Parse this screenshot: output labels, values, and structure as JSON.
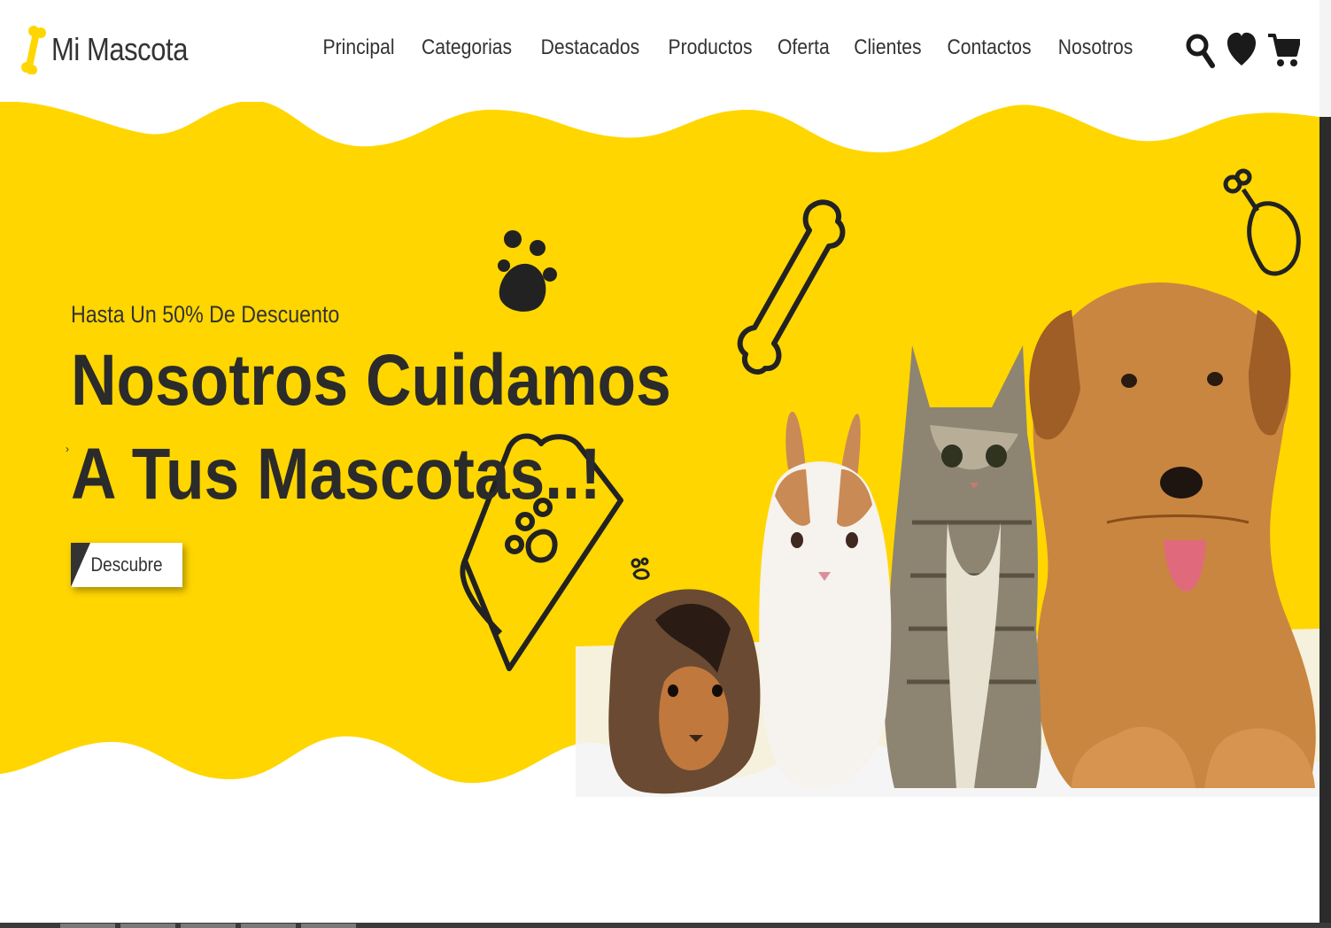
{
  "header": {
    "logo_text": "Mi Mascota",
    "nav": [
      "Principal",
      "Categorias",
      "Destacados",
      "Productos",
      "Oferta",
      "Clientes",
      "Contactos",
      "Nosotros"
    ],
    "icons": [
      "search-icon",
      "heart-icon",
      "cart-icon"
    ]
  },
  "hero": {
    "subtitle": "Hasta Un 50% De Descuento",
    "title_line1": "Nosotros Cuidamos",
    "title_line2": "A Tus Mascotas..!",
    "button_label": "Descubre"
  },
  "colors": {
    "brand_yellow": "#FFD600",
    "text_dark": "#333333",
    "white": "#FFFFFF"
  }
}
